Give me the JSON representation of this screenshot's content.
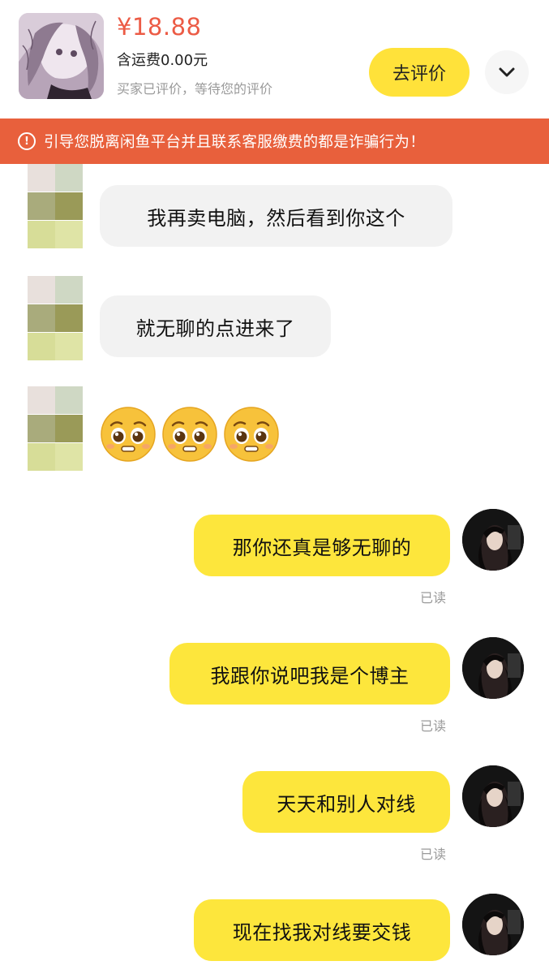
{
  "header": {
    "price": "¥18.88",
    "shipping": "含运费0.00元",
    "review_hint": "买家已评价，等待您的评价",
    "review_button": "去评价"
  },
  "warning": {
    "text": "引导您脱离闲鱼平台并且联系客服缴费的都是诈骗行为！",
    "icon": "exclamation-circle-icon"
  },
  "messages": [
    {
      "side": "in",
      "text": "我再卖电脑，然后看到你这个"
    },
    {
      "side": "in",
      "text": "就无聊的点进来了"
    },
    {
      "side": "in",
      "emoji": [
        "pleading-face-emoji",
        "pleading-face-emoji",
        "pleading-face-emoji"
      ]
    },
    {
      "side": "out",
      "text": "那你还真是够无聊的",
      "status": "已读"
    },
    {
      "side": "out",
      "text": "我跟你说吧我是个博主",
      "status": "已读"
    },
    {
      "side": "out",
      "text": "天天和别人对线",
      "status": "已读"
    },
    {
      "side": "out",
      "text": "现在找我对线要交钱"
    }
  ],
  "colors": {
    "accent_yellow": "#ffe23a",
    "warning_orange": "#e8603c",
    "price_red": "#ec5b45",
    "incoming_bubble": "#f2f2f2",
    "outgoing_bubble": "#fde63c"
  }
}
